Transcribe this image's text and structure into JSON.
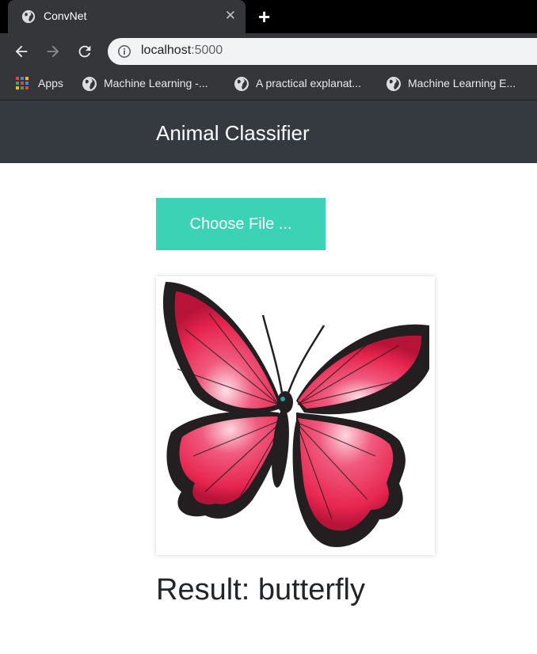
{
  "browser": {
    "tab_title": "ConvNet",
    "url_host": "localhost",
    "url_port": ":5000",
    "bookmarks": [
      {
        "label": "Apps",
        "icon": "apps-grid-icon"
      },
      {
        "label": "Machine Learning -...",
        "icon": "globe-icon"
      },
      {
        "label": "A practical explanat...",
        "icon": "globe-icon"
      },
      {
        "label": "Machine Learning E...",
        "icon": "globe-icon"
      }
    ]
  },
  "app": {
    "brand": "Animal Classifier",
    "upload_label": "Choose File ...",
    "result_text": "Result: butterfly",
    "preview_image": "butterfly"
  },
  "colors": {
    "navbar": "#343a40",
    "accent_button": "#3cd2b5",
    "wing": "#e8264f",
    "wing_edge": "#231f20"
  }
}
